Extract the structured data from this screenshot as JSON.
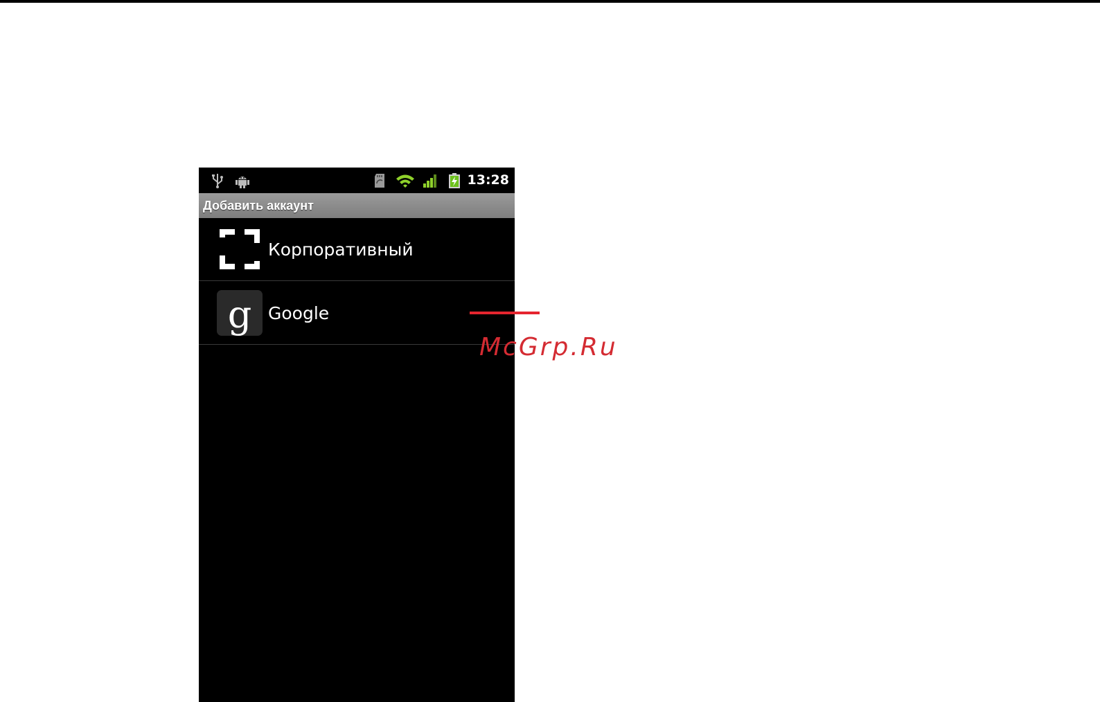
{
  "status_bar": {
    "time": "13:28",
    "left_icons": [
      "usb-icon",
      "android-debug-icon"
    ],
    "right_icons": [
      "sd-card-icon",
      "wifi-icon",
      "signal-icon",
      "battery-charging-icon"
    ]
  },
  "title_bar": {
    "title": "Добавить аккаунт"
  },
  "accounts": [
    {
      "label": "Корпоративный",
      "icon": "corporate-exchange-icon"
    },
    {
      "label": "Google",
      "icon": "google-g-icon"
    }
  ],
  "watermark": {
    "text": "McGrp.Ru"
  },
  "colors": {
    "accent_red": "#e5252f",
    "title_bar": "#8a8a8a",
    "wifi_green": "#8fd12b",
    "battery_green": "#6cc11d"
  }
}
